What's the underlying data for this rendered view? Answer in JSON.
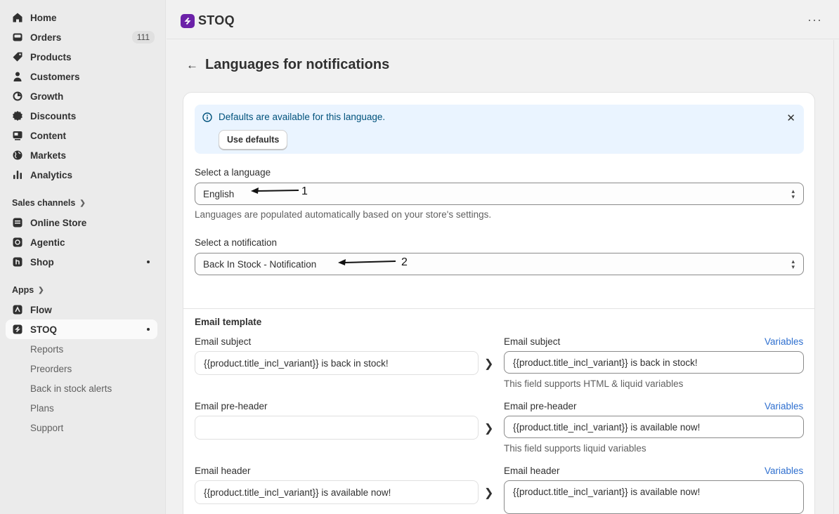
{
  "sidebar": {
    "items": [
      {
        "label": "Home",
        "icon": "home-icon"
      },
      {
        "label": "Orders",
        "icon": "orders-icon",
        "badge": "111"
      },
      {
        "label": "Products",
        "icon": "tag-icon"
      },
      {
        "label": "Customers",
        "icon": "person-icon"
      },
      {
        "label": "Growth",
        "icon": "growth-icon"
      },
      {
        "label": "Discounts",
        "icon": "discount-icon"
      },
      {
        "label": "Content",
        "icon": "content-icon"
      },
      {
        "label": "Markets",
        "icon": "globe-icon"
      },
      {
        "label": "Analytics",
        "icon": "chart-icon"
      }
    ],
    "sales_channels_label": "Sales channels",
    "channels": [
      {
        "label": "Online Store",
        "icon": "store-icon"
      },
      {
        "label": "Agentic",
        "icon": "agentic-icon"
      },
      {
        "label": "Shop",
        "icon": "shop-icon"
      }
    ],
    "apps_label": "Apps",
    "apps": [
      {
        "label": "Flow",
        "icon": "flow-icon"
      },
      {
        "label": "STOQ",
        "icon": "stoq-icon"
      }
    ],
    "stoq_subitems": [
      "Reports",
      "Preorders",
      "Back in stock alerts",
      "Plans",
      "Support"
    ]
  },
  "header": {
    "app_name": "STOQ",
    "more_label": "···"
  },
  "page": {
    "title": "Languages for notifications",
    "banner": {
      "message": "Defaults are available for this language.",
      "button": "Use defaults"
    },
    "language": {
      "label": "Select a language",
      "value": "English",
      "help": "Languages are populated automatically based on your store's settings."
    },
    "notification": {
      "label": "Select a notification",
      "value": "Back In Stock - Notification"
    },
    "annotations": [
      "1",
      "2"
    ],
    "email_template": {
      "title": "Email template",
      "variables_link": "Variables",
      "subject": {
        "label": "Email subject",
        "default_value": "{{product.title_incl_variant}} is back in stock!",
        "value": "{{product.title_incl_variant}} is back in stock!",
        "help": "This field supports HTML & liquid variables"
      },
      "preheader": {
        "label": "Email pre-header",
        "default_value": "",
        "value": "{{product.title_incl_variant}} is available now!",
        "help": "This field supports liquid variables"
      },
      "header": {
        "label": "Email header",
        "default_value": "{{product.title_incl_variant}} is available now!",
        "value": "{{product.title_incl_variant}} is available now!"
      }
    }
  }
}
